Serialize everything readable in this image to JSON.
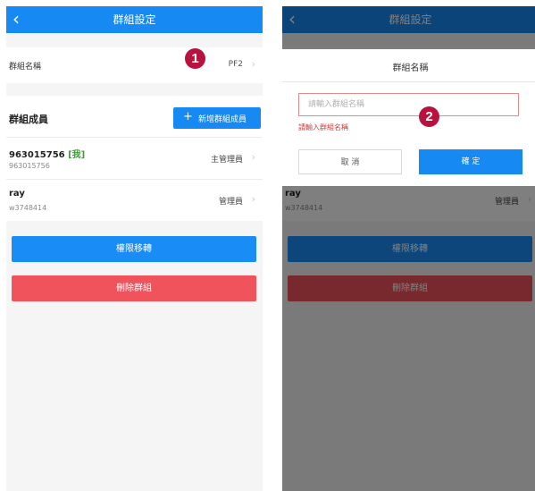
{
  "header": {
    "title": "群組設定",
    "back_icon": "chevron-left-icon"
  },
  "group_name": {
    "label": "群組名稱",
    "value": "PF2"
  },
  "members": {
    "title": "群組成員",
    "add_label": "新增群組成員",
    "items": [
      {
        "name": "963015756",
        "tag": "[我]",
        "id": "963015756",
        "role": "主管理員"
      },
      {
        "name": "ray",
        "tag": "",
        "id": "w3748414",
        "role": "管理員"
      }
    ]
  },
  "actions": {
    "transfer_label": "權限移轉",
    "delete_label": "刪除群組"
  },
  "callouts": {
    "one": "1",
    "two": "2"
  },
  "dialog": {
    "title": "群組名稱",
    "placeholder": "請輸入群組名稱",
    "error": "請輸入群組名稱",
    "cancel_label": "取 消",
    "confirm_label": "確 定"
  },
  "colors": {
    "primary": "#1689f2",
    "danger": "#f0535b",
    "callout": "#b8123f",
    "me_tag": "#3f9a37"
  }
}
